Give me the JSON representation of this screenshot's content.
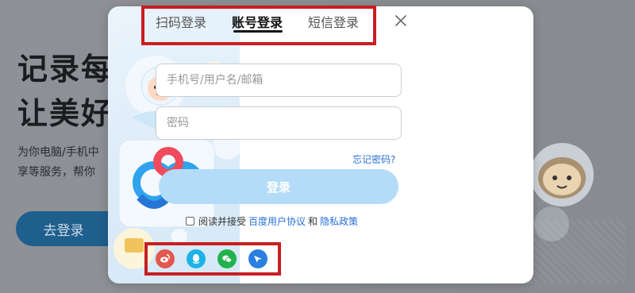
{
  "background": {
    "headline_line1": "记录每",
    "headline_line2": "让美好",
    "sub_line1": "为你电脑/手机中",
    "sub_line2": "享等服务，帮你",
    "login_button": "去登录"
  },
  "modal": {
    "tabs": [
      {
        "label": "扫码登录",
        "active": false
      },
      {
        "label": "账号登录",
        "active": true
      },
      {
        "label": "短信登录",
        "active": false
      }
    ],
    "close_icon": "close-icon",
    "username_placeholder": "手机号/用户名/邮箱",
    "password_placeholder": "密码",
    "forgot_password": "忘记密码?",
    "login_button": "登录",
    "agreement": {
      "prefix": "阅读并接受",
      "user_agreement": "百度用户协议",
      "and": "和",
      "privacy_policy": "隐私政策"
    },
    "social_logins": [
      "weibo-icon",
      "qq-icon",
      "wechat-icon",
      "tieba-icon"
    ]
  },
  "colors": {
    "highlight_box": "#c81e22",
    "login_button_bg": "#b4dcf9",
    "link": "#2a6fd6",
    "weibo": "#e2584f",
    "qq": "#1db3e6",
    "wechat": "#22b24c",
    "tieba": "#2a7fe0"
  }
}
